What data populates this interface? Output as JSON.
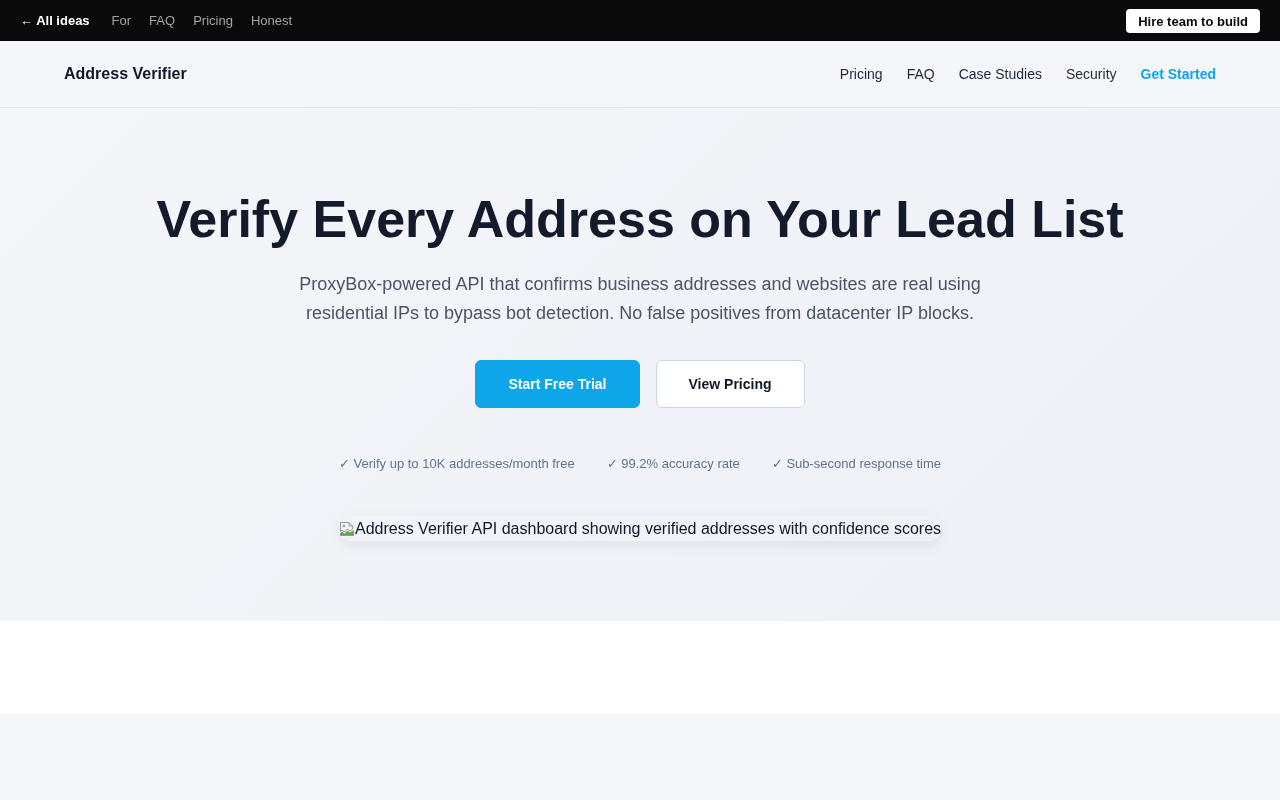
{
  "top_bar": {
    "back_link": "← All ideas",
    "links": [
      "For",
      "FAQ",
      "Pricing",
      "Honest"
    ],
    "button": "Hire team to build"
  },
  "nav": {
    "brand": "Address Verifier",
    "links": [
      {
        "label": "Pricing",
        "kind": "plain"
      },
      {
        "label": "FAQ",
        "kind": "plain"
      },
      {
        "label": "Case Studies",
        "kind": "plain"
      },
      {
        "label": "Security",
        "kind": "plain"
      },
      {
        "label": "Get Started",
        "kind": "cta"
      }
    ]
  },
  "hero": {
    "title": "Verify Every Address on Your Lead List",
    "subtitle": "ProxyBox-powered API that confirms business addresses and websites are real using residential IPs to bypass bot detection. No false positives from datacenter IP blocks.",
    "buttons": [
      {
        "label": "Start Free Trial",
        "kind": "primary"
      },
      {
        "label": "View Pricing",
        "kind": "secondary"
      }
    ],
    "features": [
      "✓ Verify up to 10K addresses/month free",
      "✓ 99.2% accuracy rate",
      "✓ Sub-second response time"
    ],
    "image": {
      "alt": "Address Verifier API dashboard showing verified addresses with confidence scores"
    }
  }
}
